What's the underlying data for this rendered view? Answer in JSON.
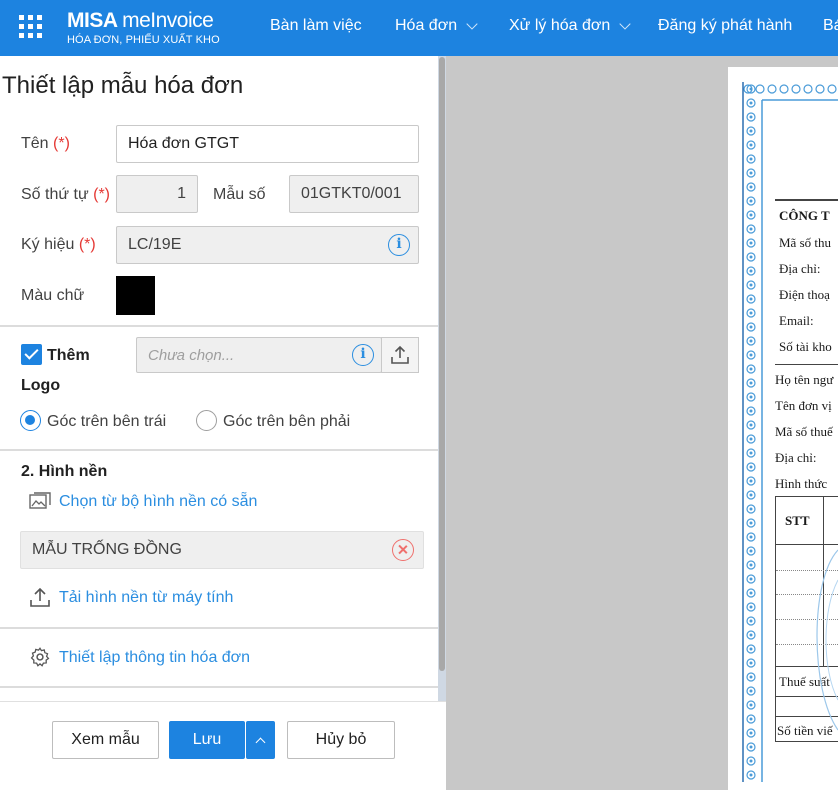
{
  "topbar": {
    "brand_name_bold": "MISA",
    "brand_name_light": "meInvoice",
    "brand_subtitle": "HÓA ĐƠN, PHIẾU XUẤT KHO",
    "nav": [
      "Bàn làm việc",
      "Hóa đơn",
      "Xử lý hóa đơn",
      "Đăng ký phát hành",
      "Bá"
    ]
  },
  "panel": {
    "title": "Thiết lập mẫu hóa đơn",
    "required_mark": "(*)",
    "name_label": "Tên",
    "name_value": "Hóa đơn GTGT",
    "order_label": "Số thứ tự",
    "order_value": "1",
    "template_no_label": "Mẫu số",
    "template_no_value": "01GTKT0/001",
    "symbol_label": "Ký hiệu",
    "symbol_value": "LC/19E",
    "text_color_label": "Màu chữ",
    "text_color": "#000000",
    "logo_checkbox_label": "Thêm",
    "logo_label": "Logo",
    "logo_placeholder": "Chưa chọn...",
    "logo_position_left": "Góc trên bên trái",
    "logo_position_right": "Góc trên bên phải",
    "background_section": "2. Hình nền",
    "choose_background_link": "Chọn từ bộ hình nền có sẵn",
    "background_value": "MẪU TRỐNG ĐỒNG",
    "upload_background_link": "Tải hình nền từ máy tính",
    "invoice_settings_link": "Thiết lập thông tin hóa đơn"
  },
  "footer": {
    "preview_label": "Xem mẫu",
    "save_label": "Lưu",
    "cancel_label": "Hủy bỏ"
  },
  "preview": {
    "lines": [
      "CÔNG T",
      "Mã số thu",
      "Địa chỉ:",
      "Điện thoạ",
      "Email:",
      "Số tài kho",
      "Họ tên ngư",
      "Tên đơn vị",
      "Mã số thuế",
      "Địa chỉ:",
      "Hình thức"
    ],
    "table_header": "STT",
    "tax_rate": "Thuế suất",
    "amount_words": "Số tiền viế"
  },
  "colors": {
    "accent": "#1d83e0",
    "link": "#2b8ee0",
    "required": "#e53935",
    "clear": "#ef6f6c"
  }
}
